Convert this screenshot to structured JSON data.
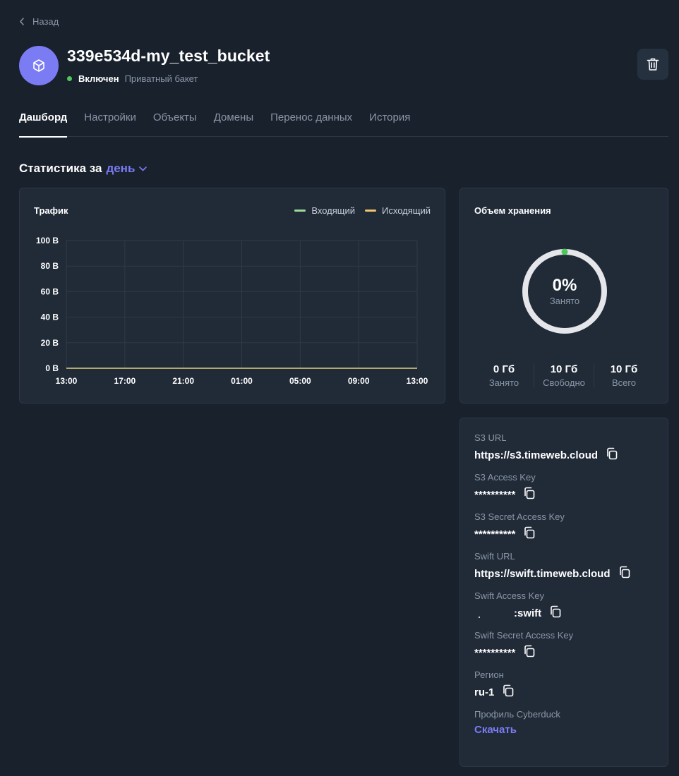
{
  "nav": {
    "back_label": "Назад"
  },
  "bucket": {
    "name": "339e534d-my_test_bucket",
    "status": "Включен",
    "type": "Приватный бакет",
    "status_color": "#4cc959",
    "avatar_color": "#7b7bf4"
  },
  "tabs": [
    "Дашборд",
    "Настройки",
    "Объекты",
    "Домены",
    "Перенос данных",
    "История"
  ],
  "stats": {
    "heading": "Статистика за",
    "period": "день"
  },
  "traffic": {
    "title": "Трафик",
    "legend": [
      {
        "name": "Входящий",
        "color": "#9fd99a"
      },
      {
        "name": "Исходящий",
        "color": "#f2c46d"
      }
    ]
  },
  "chart_data": {
    "type": "line",
    "title": "Трафик",
    "x": [
      "13:00",
      "17:00",
      "21:00",
      "01:00",
      "05:00",
      "09:00",
      "13:00"
    ],
    "yticks": [
      "0 B",
      "20 B",
      "40 B",
      "60 B",
      "80 B",
      "100 B"
    ],
    "ylim": [
      0,
      100
    ],
    "grid": true,
    "legend_position": "top-right",
    "series": [
      {
        "name": "Входящий",
        "color": "#9fd99a",
        "values": [
          0,
          0,
          0,
          0,
          0,
          0,
          0
        ]
      },
      {
        "name": "Исходящий",
        "color": "#f2c46d",
        "values": [
          0,
          0,
          0,
          0,
          0,
          0,
          0
        ]
      }
    ]
  },
  "storage": {
    "title": "Объем хранения",
    "percent": "0%",
    "percent_value": 0,
    "percent_label": "Занято",
    "stats": [
      {
        "value": "0 Гб",
        "label": "Занято"
      },
      {
        "value": "10 Гб",
        "label": "Свободно"
      },
      {
        "value": "10 Гб",
        "label": "Всего"
      }
    ]
  },
  "info": {
    "s3_url_label": "S3 URL",
    "s3_url": "https://s3.timeweb.cloud",
    "s3_key_label": "S3 Access Key",
    "s3_key": "**********",
    "s3_secret_label": "S3 Secret Access Key",
    "s3_secret": "**********",
    "swift_url_label": "Swift URL",
    "swift_url": "https://swift.timeweb.cloud",
    "swift_key_label": "Swift Access Key",
    "swift_key_suffix": ":swift",
    "swift_secret_label": "Swift Secret Access Key",
    "swift_secret": "**********",
    "region_label": "Регион",
    "region": "ru-1",
    "cyberduck_label": "Профиль Cyberduck",
    "cyberduck_link": "Скачать"
  },
  "icons": {
    "back": "chevron-left-icon",
    "bucket": "cube-icon",
    "delete": "trash-icon",
    "period": "chevron-down-icon",
    "copy": "copy-icon"
  }
}
